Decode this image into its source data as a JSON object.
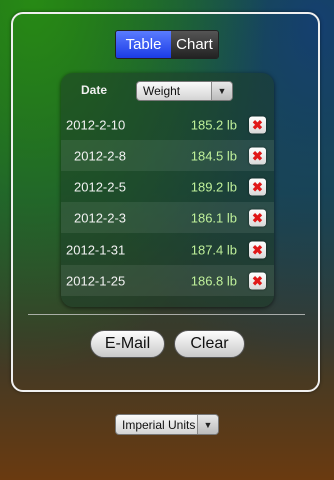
{
  "segment": {
    "table_label": "Table",
    "chart_label": "Chart",
    "selected": "Table"
  },
  "table": {
    "date_header": "Date",
    "column_select": "Weight",
    "rows": [
      {
        "date": "2012-2-10",
        "weight": "185.2 lb"
      },
      {
        "date": "2012-2-8",
        "weight": "184.5 lb"
      },
      {
        "date": "2012-2-5",
        "weight": "189.2 lb"
      },
      {
        "date": "2012-2-3",
        "weight": "186.1 lb"
      },
      {
        "date": "2012-1-31",
        "weight": "187.4 lb"
      },
      {
        "date": "2012-1-25",
        "weight": "186.8 lb"
      }
    ],
    "delete_glyph": "✖"
  },
  "buttons": {
    "email": "E-Mail",
    "clear": "Clear"
  },
  "units_select": "Imperial Units",
  "colors": {
    "segment_selected": "#2a48f0",
    "weight_text": "#bff09a",
    "delete_mark": "#e01818"
  },
  "icons": {
    "delete": "close-x-icon",
    "dropdown": "triangle-down-icon"
  }
}
